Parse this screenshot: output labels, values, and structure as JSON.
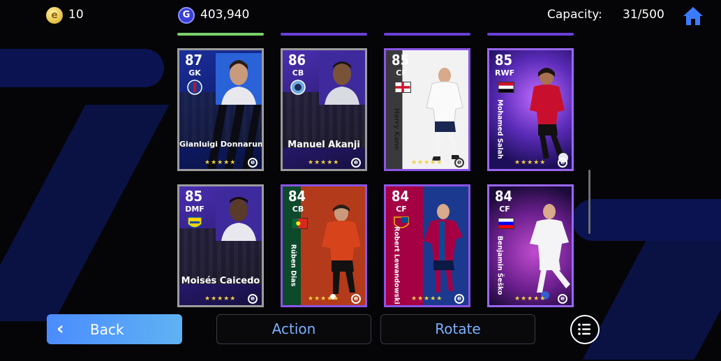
{
  "header": {
    "coins": "10",
    "coin_icon": "e-coin-icon",
    "gp": "403,940",
    "gp_icon_letter": "G",
    "capacity_label": "Capacity:",
    "capacity_value": "31/500",
    "home_icon": "home-icon"
  },
  "cards": [
    {
      "rating": "87",
      "position": "GK",
      "name": "Gianluigi Donnarumma",
      "stars": "★★★★★",
      "style": "standard-blue"
    },
    {
      "rating": "86",
      "position": "CB",
      "name": "Manuel Akanji",
      "stars": "★★★★★",
      "style": "standard-purple"
    },
    {
      "rating": "85",
      "position": "CF",
      "name": "Harry Kane",
      "stars": "★★★★★",
      "style": "special-white",
      "flag": "England"
    },
    {
      "rating": "85",
      "position": "RWF",
      "name": "Mohamed Salah",
      "stars": "★★★★★",
      "style": "special-neon",
      "flag": "Egypt"
    },
    {
      "rating": "85",
      "position": "DMF",
      "name": "Moisés Caicedo",
      "stars": "★★★★★",
      "style": "standard-purple"
    },
    {
      "rating": "84",
      "position": "CB",
      "name": "Rúben Dias",
      "stars": "★★★★★",
      "style": "special-red",
      "flag": "Portugal"
    },
    {
      "rating": "84",
      "position": "CF",
      "name": "Robert Lewandowski",
      "stars": "★★★★★",
      "style": "special-blaugrana"
    },
    {
      "rating": "84",
      "position": "CF",
      "name": "Benjamin Šeško",
      "stars": "★★★★★",
      "style": "special-pink",
      "flag": "Slovenia"
    }
  ],
  "footer": {
    "back_label": "Back",
    "action_label": "Action",
    "rotate_label": "Rotate",
    "menu_icon": "list-menu-icon"
  },
  "colors": {
    "accent_blue": "#5aa0ff",
    "star_gold": "#f2d040",
    "background": "#050507"
  }
}
